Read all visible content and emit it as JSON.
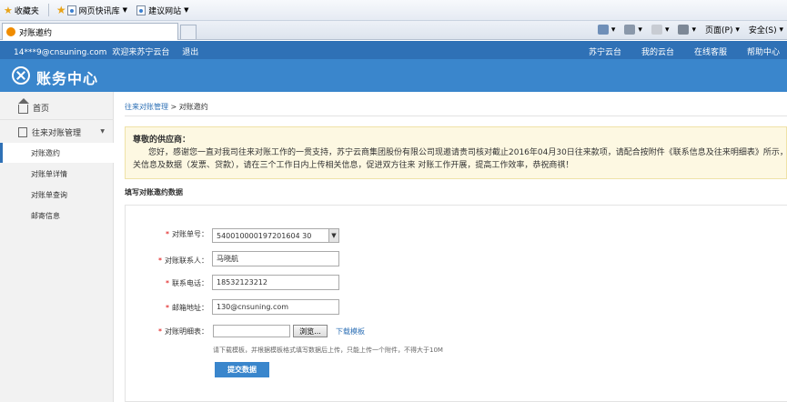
{
  "browser": {
    "favorites_label": "收藏夹",
    "fav_items": [
      "网页快讯库",
      "建议网站"
    ],
    "tab_title": "对账邀约",
    "commands": [
      "页面(P)",
      "安全(S)"
    ]
  },
  "topbar": {
    "user": "14***9@cnsuning.com",
    "welcome": "欢迎来苏宁云台",
    "logout": "退出",
    "links": [
      "苏宁云台",
      "我的云台",
      "在线客服",
      "帮助中心"
    ]
  },
  "header": {
    "title": "账务中心"
  },
  "sidebar": {
    "home": "首页",
    "group": "往来对账管理",
    "items": [
      "对账邀约",
      "对账单详情",
      "对账单查询",
      "邮寄信息"
    ],
    "active_index": 0
  },
  "breadcrumb": {
    "parent": "往来对账管理",
    "separator": ">",
    "current": "对账邀约"
  },
  "notice": {
    "title": "尊敬的供应商：",
    "line1": "您好，感谢您一直对我司往来对账工作的一贯支持，苏宁云商集团股份有限公司现邀请贵司核对截止2016年04月30日往来款项，请配合按附件《联系信息及往来明细表》所示，",
    "line2": "关信息及数据（发票、贷款），请在三个工作日内上传相关信息，促进双方往来 对账工作开展，提高工作效率，恭祝商祺！"
  },
  "form": {
    "section_title": "填写对账邀约数据",
    "fields": {
      "bill_no": {
        "label": "对账单号：",
        "value": "540010000197201604 30"
      },
      "contact": {
        "label": "对账联系人：",
        "value": "马晓航"
      },
      "phone": {
        "label": "联系电话：",
        "value": "18532123212"
      },
      "email": {
        "label": "邮箱地址：",
        "value": "130@cnsuning.com"
      },
      "detail": {
        "label": "对账明细表：",
        "browse": "浏览...",
        "download": "下载模板"
      }
    },
    "hint": "请下载模板，并根据模板格式填写数据后上传，只能上传一个附件，不得大于10M",
    "submit": "提交数据"
  }
}
